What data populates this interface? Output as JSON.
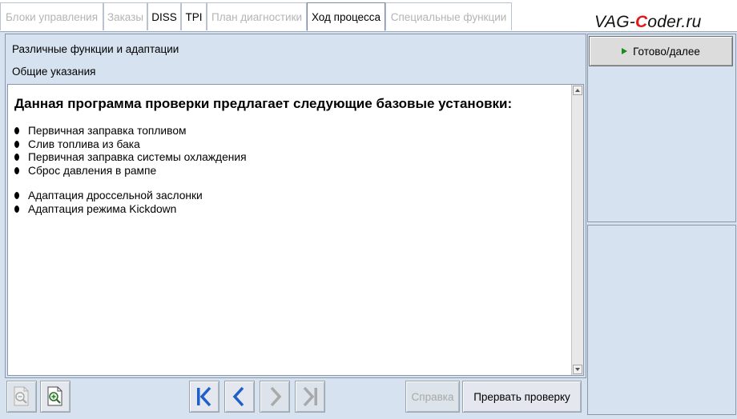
{
  "tabs": [
    {
      "label": "Блоки управления",
      "state": "disabled"
    },
    {
      "label": "Заказы",
      "state": "disabled"
    },
    {
      "label": "DISS",
      "state": "enabled"
    },
    {
      "label": "TPI",
      "state": "enabled"
    },
    {
      "label": "План диагностики",
      "state": "disabled"
    },
    {
      "label": "Ход процесса",
      "state": "active"
    },
    {
      "label": "Специальные функции",
      "state": "disabled"
    }
  ],
  "logo": {
    "part1": "VAG-",
    "accent": "C",
    "part2": "oder.ru"
  },
  "header": {
    "line1": "Различные функции и адаптации",
    "line2": "Общие указания"
  },
  "content": {
    "heading": "Данная программа проверки предлагает следующие базовые установки:",
    "group1": [
      "Первичная заправка топливом",
      "Слив топлива из бака",
      "Первичная заправка системы охлаждения",
      "Сброс давления в рампе"
    ],
    "group2": [
      "Адаптация дроссельной заслонки",
      "Адаптация режима Kickdown"
    ]
  },
  "right_panel": {
    "next_button": "Готово/далее"
  },
  "toolbar": {
    "help_label": "Справка",
    "abort_label": "Прервать проверку"
  },
  "colors": {
    "panel_bg": "#d6e2ef",
    "nav_blue": "#1f5fc9",
    "nav_disabled": "#a9a9a9",
    "play_green": "#1a8a1a",
    "logo_accent": "#e01818"
  }
}
